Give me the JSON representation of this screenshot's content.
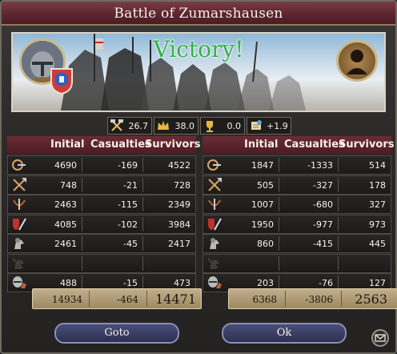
{
  "window": {
    "title": "Battle of Zumarshausen"
  },
  "banner": {
    "result": "Victory!"
  },
  "stats": [
    {
      "icon": "crossed-hammers-icon",
      "value": "26.7"
    },
    {
      "icon": "crown-icon",
      "value": "38.0"
    },
    {
      "icon": "trophy-icon",
      "value": "0.0"
    },
    {
      "icon": "scroll-icon",
      "value": "+1.9"
    }
  ],
  "columns": {
    "initial": "Initial",
    "casualties": "Casualties",
    "survivors": "Survivors"
  },
  "left": {
    "rows": [
      {
        "unit": "archer-icon",
        "initial": "4690",
        "casualties": "-169",
        "survivors": "4522"
      },
      {
        "unit": "pikeman-icon",
        "initial": "748",
        "casualties": "-21",
        "survivors": "728"
      },
      {
        "unit": "crossbow-icon",
        "initial": "2463",
        "casualties": "-115",
        "survivors": "2349"
      },
      {
        "unit": "swordsman-icon",
        "initial": "4085",
        "casualties": "-102",
        "survivors": "3984"
      },
      {
        "unit": "light-cavalry-icon",
        "initial": "2461",
        "casualties": "-45",
        "survivors": "2417"
      },
      {
        "unit": "horse-archer-icon",
        "initial": "",
        "casualties": "",
        "survivors": ""
      },
      {
        "unit": "heavy-cavalry-icon",
        "initial": "488",
        "casualties": "-15",
        "survivors": "473"
      }
    ],
    "totals": {
      "initial": "14934",
      "casualties": "-464",
      "survivors": "14471"
    }
  },
  "right": {
    "rows": [
      {
        "unit": "archer-icon",
        "initial": "1847",
        "casualties": "-1333",
        "survivors": "514"
      },
      {
        "unit": "pikeman-icon",
        "initial": "505",
        "casualties": "-327",
        "survivors": "178"
      },
      {
        "unit": "crossbow-icon",
        "initial": "1007",
        "casualties": "-680",
        "survivors": "327"
      },
      {
        "unit": "swordsman-icon",
        "initial": "1950",
        "casualties": "-977",
        "survivors": "973"
      },
      {
        "unit": "light-cavalry-icon",
        "initial": "860",
        "casualties": "-415",
        "survivors": "445"
      },
      {
        "unit": "horse-archer-icon",
        "initial": "",
        "casualties": "",
        "survivors": ""
      },
      {
        "unit": "heavy-cavalry-icon",
        "initial": "203",
        "casualties": "-76",
        "survivors": "127"
      }
    ],
    "totals": {
      "initial": "6368",
      "casualties": "-3806",
      "survivors": "2563"
    }
  },
  "buttons": {
    "goto": "Goto",
    "ok": "Ok"
  },
  "colors": {
    "victory": "#2eb24a",
    "title_bar": "#5e2630",
    "totals_bar": "#b09c76",
    "button": "#3a3e66"
  }
}
